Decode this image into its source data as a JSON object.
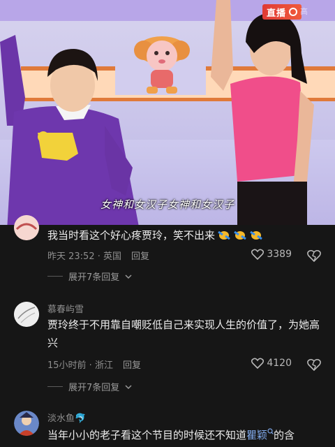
{
  "video": {
    "live_badge": "直播",
    "corner_mark": "高",
    "subtitle": "女神和女汉子女神和女汉子"
  },
  "comments": [
    {
      "username": "",
      "text": "我当时看这个好心疼贾玲，笑不出来",
      "emoji": "cry-laugh-emoji",
      "time_location": "昨天 23:52 · 英国",
      "reply_label": "回复",
      "likes": "3389",
      "expand_label": "展开7条回复"
    },
    {
      "username": "慕春屿雪",
      "text": "贾玲终于不用靠自嘲贬低自己来实现人生的价值了，为她高兴",
      "time_location": "15小时前 · 浙江",
      "reply_label": "回复",
      "likes": "4120",
      "expand_label": "展开7条回复"
    },
    {
      "username": "淡水鱼🐬",
      "text_before": "当年小小的老子看这个节目的时候还不知道",
      "text_link": "瞿颖",
      "text_after": "的含",
      "search_icon": "search-small-icon"
    }
  ],
  "colors": {
    "background": "#161616",
    "link": "#7ea7e8",
    "muted": "#8e8e8e"
  }
}
